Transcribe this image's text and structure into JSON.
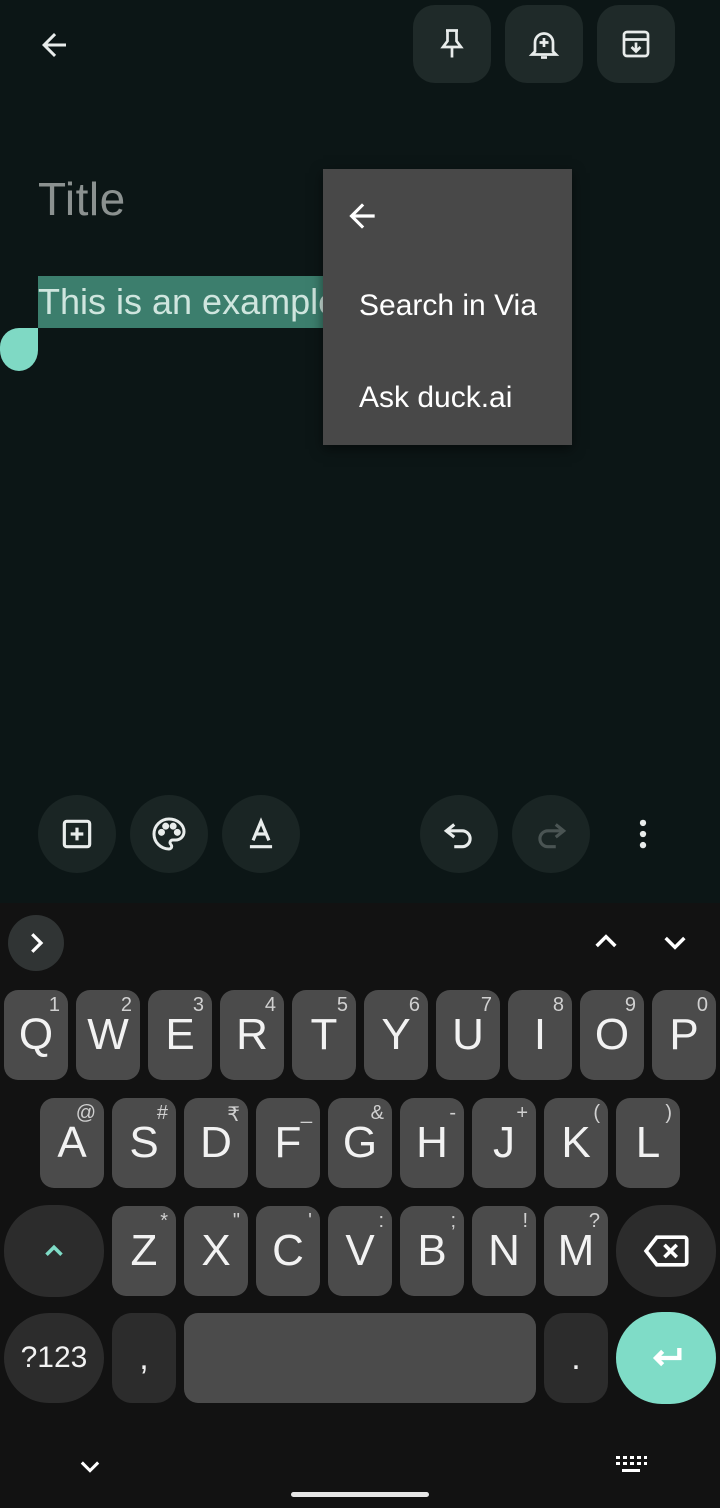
{
  "editor": {
    "title_placeholder": "Title",
    "body_text": "This is an example"
  },
  "context_menu": {
    "items": [
      "Search in Via",
      "Ask duck.ai"
    ]
  },
  "keyboard": {
    "row1": [
      {
        "label": "Q",
        "hint": "1"
      },
      {
        "label": "W",
        "hint": "2"
      },
      {
        "label": "E",
        "hint": "3"
      },
      {
        "label": "R",
        "hint": "4"
      },
      {
        "label": "T",
        "hint": "5"
      },
      {
        "label": "Y",
        "hint": "6"
      },
      {
        "label": "U",
        "hint": "7"
      },
      {
        "label": "I",
        "hint": "8"
      },
      {
        "label": "O",
        "hint": "9"
      },
      {
        "label": "P",
        "hint": "0"
      }
    ],
    "row2": [
      {
        "label": "A",
        "hint": "@"
      },
      {
        "label": "S",
        "hint": "#"
      },
      {
        "label": "D",
        "hint": "₹"
      },
      {
        "label": "F",
        "hint": "_"
      },
      {
        "label": "G",
        "hint": "&"
      },
      {
        "label": "H",
        "hint": "-"
      },
      {
        "label": "J",
        "hint": "+"
      },
      {
        "label": "K",
        "hint": "("
      },
      {
        "label": "L",
        "hint": ")"
      }
    ],
    "row3": [
      {
        "label": "Z",
        "hint": "*"
      },
      {
        "label": "X",
        "hint": "\""
      },
      {
        "label": "C",
        "hint": "'"
      },
      {
        "label": "V",
        "hint": ":"
      },
      {
        "label": "B",
        "hint": ";"
      },
      {
        "label": "N",
        "hint": "!"
      },
      {
        "label": "M",
        "hint": "?"
      }
    ],
    "symbols_label": "?123",
    "comma_label": ",",
    "period_label": "."
  },
  "colors": {
    "background": "#0c1616",
    "selection": "#3c7e6d",
    "accent": "#7fdcc7"
  }
}
